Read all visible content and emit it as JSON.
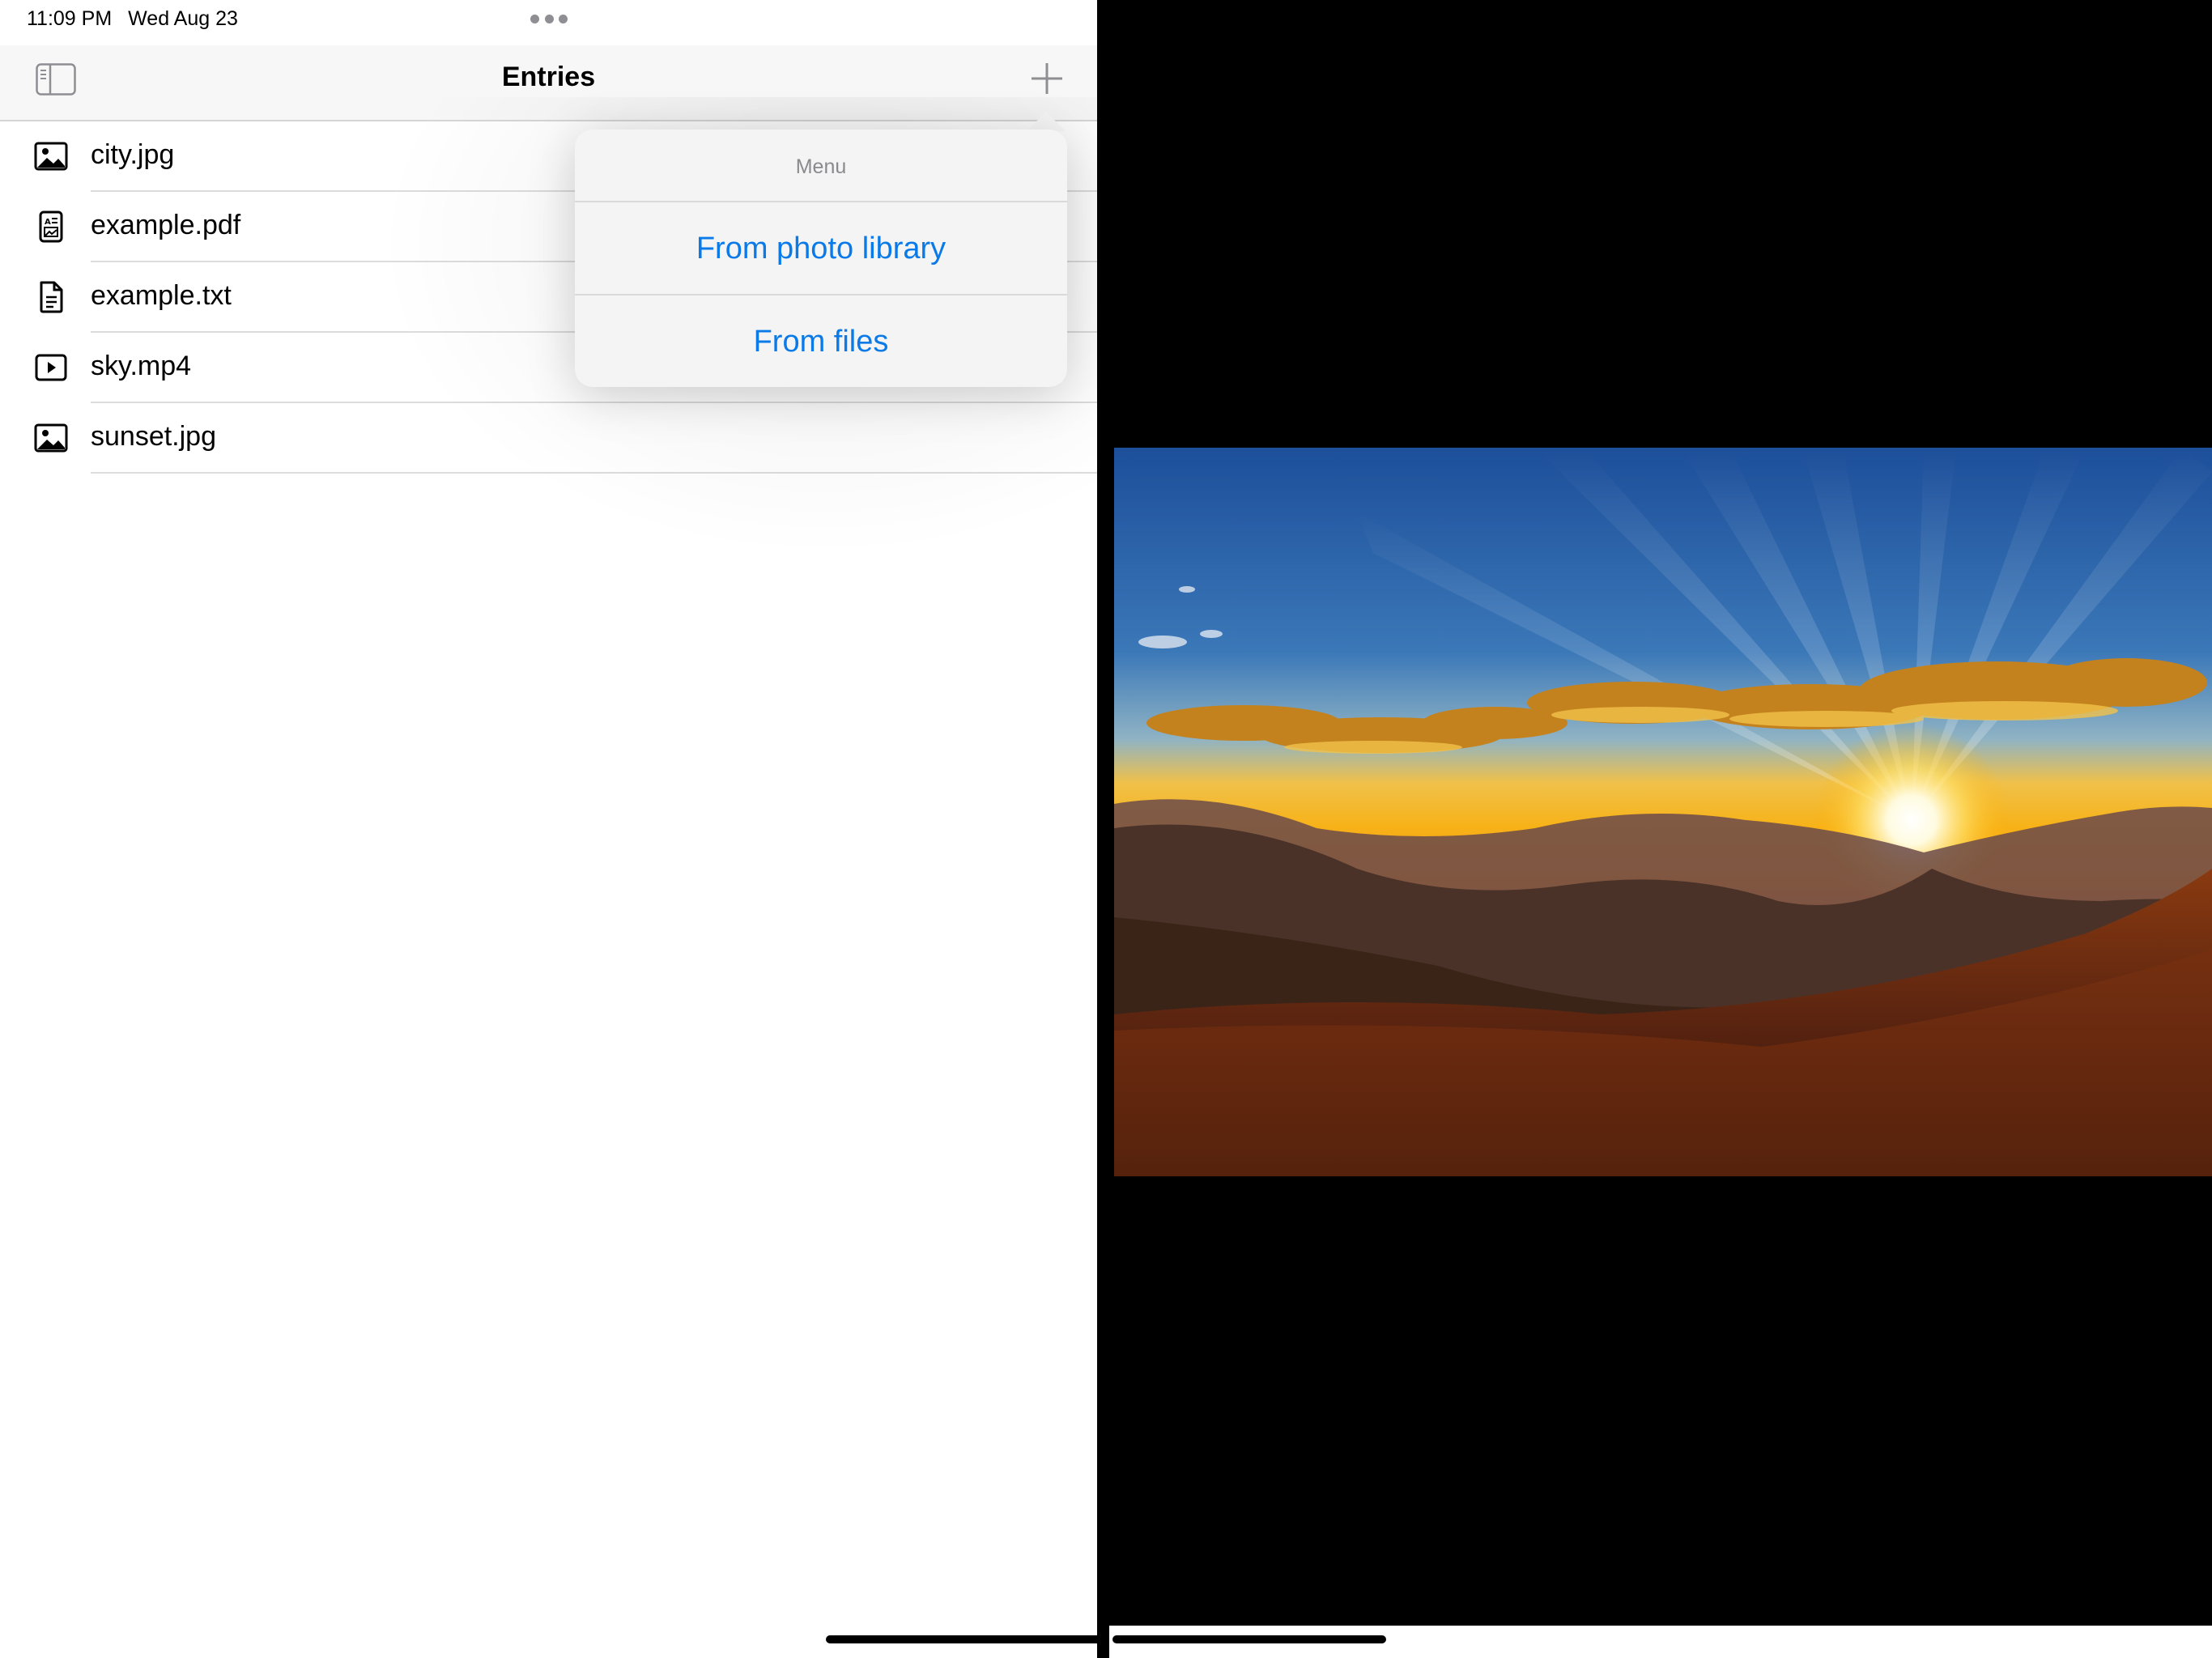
{
  "status_bar": {
    "time": "11:09 PM",
    "date": "Wed Aug 23"
  },
  "nav": {
    "title": "Entries"
  },
  "entries": [
    {
      "label": "city.jpg",
      "icon": "photo-icon"
    },
    {
      "label": "example.pdf",
      "icon": "pdf-document-icon"
    },
    {
      "label": "example.txt",
      "icon": "text-document-icon"
    },
    {
      "label": "sky.mp4",
      "icon": "video-play-icon"
    },
    {
      "label": "sunset.jpg",
      "icon": "photo-icon"
    }
  ],
  "popover": {
    "title": "Menu",
    "items": [
      "From photo library",
      "From files"
    ]
  },
  "colors": {
    "accent": "#0a7ae8",
    "pane_background": "#ffffff",
    "viewer_background": "#000000"
  }
}
